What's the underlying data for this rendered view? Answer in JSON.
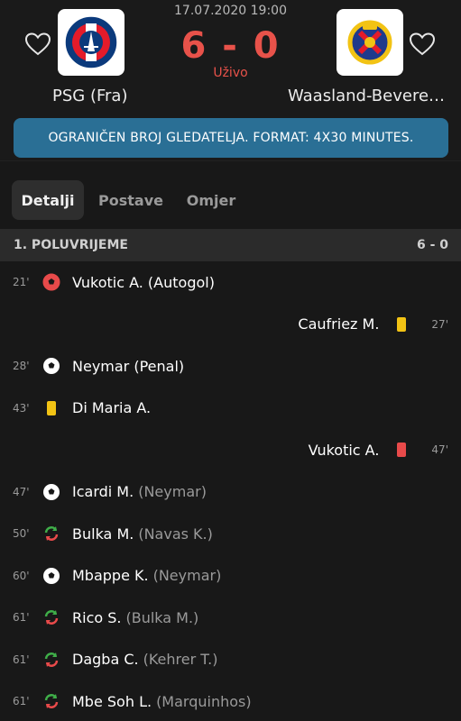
{
  "match": {
    "datetime": "17.07.2020 19:00",
    "score": "6 - 0",
    "status": "Uživo",
    "home_team": "PSG (Fra)",
    "away_team": "Waasland-Beveren...",
    "banner": "OGRANIČEN BROJ GLEDATELJA. FORMAT: 4X30 MINUTES."
  },
  "tabs": [
    {
      "label": "Detalji",
      "active": true
    },
    {
      "label": "Postave",
      "active": false
    },
    {
      "label": "Omjer",
      "active": false
    }
  ],
  "section": {
    "title": "1. POLUVRIJEME",
    "score": "6 - 0"
  },
  "events": [
    {
      "side": "home",
      "minute": "21'",
      "icon": "own-goal-ball-icon",
      "player": "Vukotic A. (Autogol)",
      "sub": ""
    },
    {
      "side": "away",
      "minute": "27'",
      "icon": "yellow-card-icon",
      "player": "Caufriez M.",
      "sub": ""
    },
    {
      "side": "home",
      "minute": "28'",
      "icon": "goal-ball-icon",
      "player": "Neymar (Penal)",
      "sub": ""
    },
    {
      "side": "home",
      "minute": "43'",
      "icon": "yellow-card-icon",
      "player": "Di Maria A.",
      "sub": ""
    },
    {
      "side": "away",
      "minute": "47'",
      "icon": "red-card-icon",
      "player": "Vukotic A.",
      "sub": ""
    },
    {
      "side": "home",
      "minute": "47'",
      "icon": "goal-ball-icon",
      "player": "Icardi M.",
      "sub": "(Neymar)"
    },
    {
      "side": "home",
      "minute": "50'",
      "icon": "substitution-icon",
      "player": "Bulka M.",
      "sub": "(Navas K.)"
    },
    {
      "side": "home",
      "minute": "60'",
      "icon": "goal-ball-icon",
      "player": "Mbappe K.",
      "sub": "(Neymar)"
    },
    {
      "side": "home",
      "minute": "61'",
      "icon": "substitution-icon",
      "player": "Rico S.",
      "sub": "(Bulka M.)"
    },
    {
      "side": "home",
      "minute": "61'",
      "icon": "substitution-icon",
      "player": "Dagba C.",
      "sub": "(Kehrer T.)"
    },
    {
      "side": "home",
      "minute": "61'",
      "icon": "substitution-icon",
      "player": "Mbe Soh L.",
      "sub": "(Marquinhos)"
    }
  ],
  "colors": {
    "score": "#e8524a",
    "banner": "#2a6f95",
    "yellow_card": "#f2c314",
    "red_card": "#e84a4a",
    "sub_in": "#3fae49",
    "sub_out": "#e84a4a"
  }
}
